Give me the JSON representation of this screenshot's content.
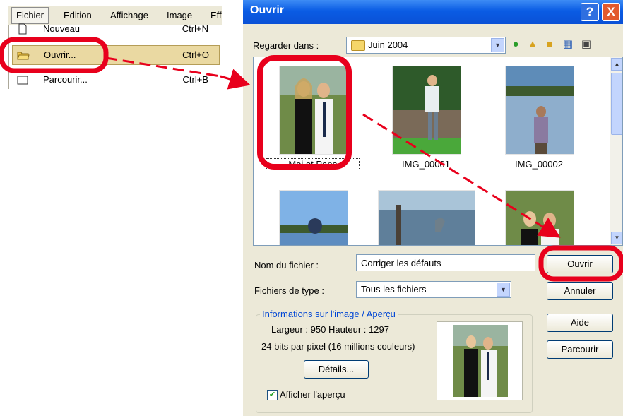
{
  "menubar": {
    "items": [
      "Fichier",
      "Edition",
      "Affichage",
      "Image",
      "Eff"
    ]
  },
  "menu": {
    "items": [
      {
        "label": "Nouveau",
        "shortcut": "Ctrl+N"
      },
      {
        "label": "Ouvrir...",
        "shortcut": "Ctrl+O"
      },
      {
        "label": "Parcourir...",
        "shortcut": "Ctrl+B"
      }
    ]
  },
  "dialog": {
    "title": "Ouvrir",
    "help_button": "?",
    "close_button": "X",
    "look_in_label": "Regarder dans :",
    "look_in_value": "Juin 2004",
    "files": [
      "Moi et Papa",
      "IMG_00001",
      "IMG_00002",
      "",
      "",
      ""
    ],
    "filename_label": "Nom du fichier :",
    "filename_value": "Corriger les défauts",
    "filetype_label": "Fichiers de type :",
    "filetype_value": "Tous les fichiers",
    "buttons": {
      "open": "Ouvrir",
      "cancel": "Annuler",
      "help": "Aide",
      "browse": "Parcourir"
    },
    "info": {
      "title": "Informations sur l'image / Aperçu",
      "dimensions": "Largeur : 950  Hauteur : 1297",
      "bits": "24 bits par pixel (16 millions couleurs)",
      "details_button": "Détails...",
      "preview_label": "Afficher l'aperçu",
      "preview_checked": true
    }
  },
  "colors": {
    "highlight": "#e8001c",
    "title_bar": "#0a5ce4",
    "menu_highlight": "#ead9a2"
  }
}
